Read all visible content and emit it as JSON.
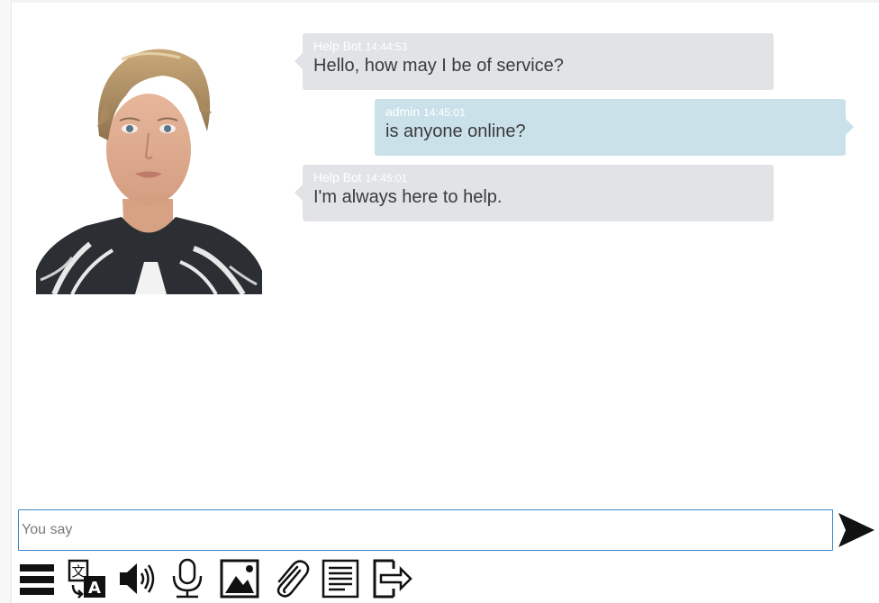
{
  "conversation": {
    "messages": [
      {
        "sender": "Help Bot",
        "time": "14:44:53",
        "text": "Hello, how may I be of service?",
        "role": "bot"
      },
      {
        "sender": "admin",
        "time": "14:45:01",
        "text": "is anyone online?",
        "role": "user"
      },
      {
        "sender": "Help Bot",
        "time": "14:45:01",
        "text": "I'm always here to help.",
        "role": "bot"
      }
    ]
  },
  "input": {
    "placeholder": "You say",
    "value": ""
  },
  "send_button": {
    "icon": "send-arrow-icon"
  },
  "toolbar": {
    "buttons": [
      {
        "icon": "menu-icon"
      },
      {
        "icon": "translate-icon"
      },
      {
        "icon": "speaker-icon"
      },
      {
        "icon": "microphone-icon"
      },
      {
        "icon": "image-icon"
      },
      {
        "icon": "attachment-icon"
      },
      {
        "icon": "transcript-icon"
      },
      {
        "icon": "exit-icon"
      }
    ]
  },
  "colors": {
    "bot_bubble": "#e1e3e6",
    "user_bubble": "#cbe1ea",
    "input_border": "#3a86c8",
    "icon": "#111111"
  }
}
